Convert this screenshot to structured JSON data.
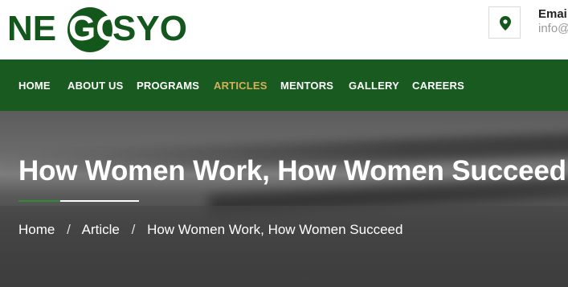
{
  "header": {
    "logo": {
      "left": "NE",
      "middle": "GO",
      "right": "SYO"
    },
    "location_icon": "map-pin-icon",
    "email_label": "Emai",
    "email_value": "info@"
  },
  "nav": {
    "items": [
      {
        "label": "HOME",
        "active": false
      },
      {
        "label": "ABOUT US",
        "active": false
      },
      {
        "label": "PROGRAMS",
        "active": false
      },
      {
        "label": "ARTICLES",
        "active": true
      },
      {
        "label": "MENTORS",
        "active": false
      },
      {
        "label": "GALLERY",
        "active": false
      },
      {
        "label": "CAREERS",
        "active": false
      }
    ]
  },
  "hero": {
    "title": "How Women Work, How Women Succeed",
    "breadcrumb": {
      "home": "Home",
      "section": "Article",
      "current": "How Women Work, How Women Succeed",
      "separator": "/"
    }
  },
  "colors": {
    "brand_green": "#185a1f",
    "active_nav": "#d4b05a",
    "underline_green": "#2f8a36"
  }
}
